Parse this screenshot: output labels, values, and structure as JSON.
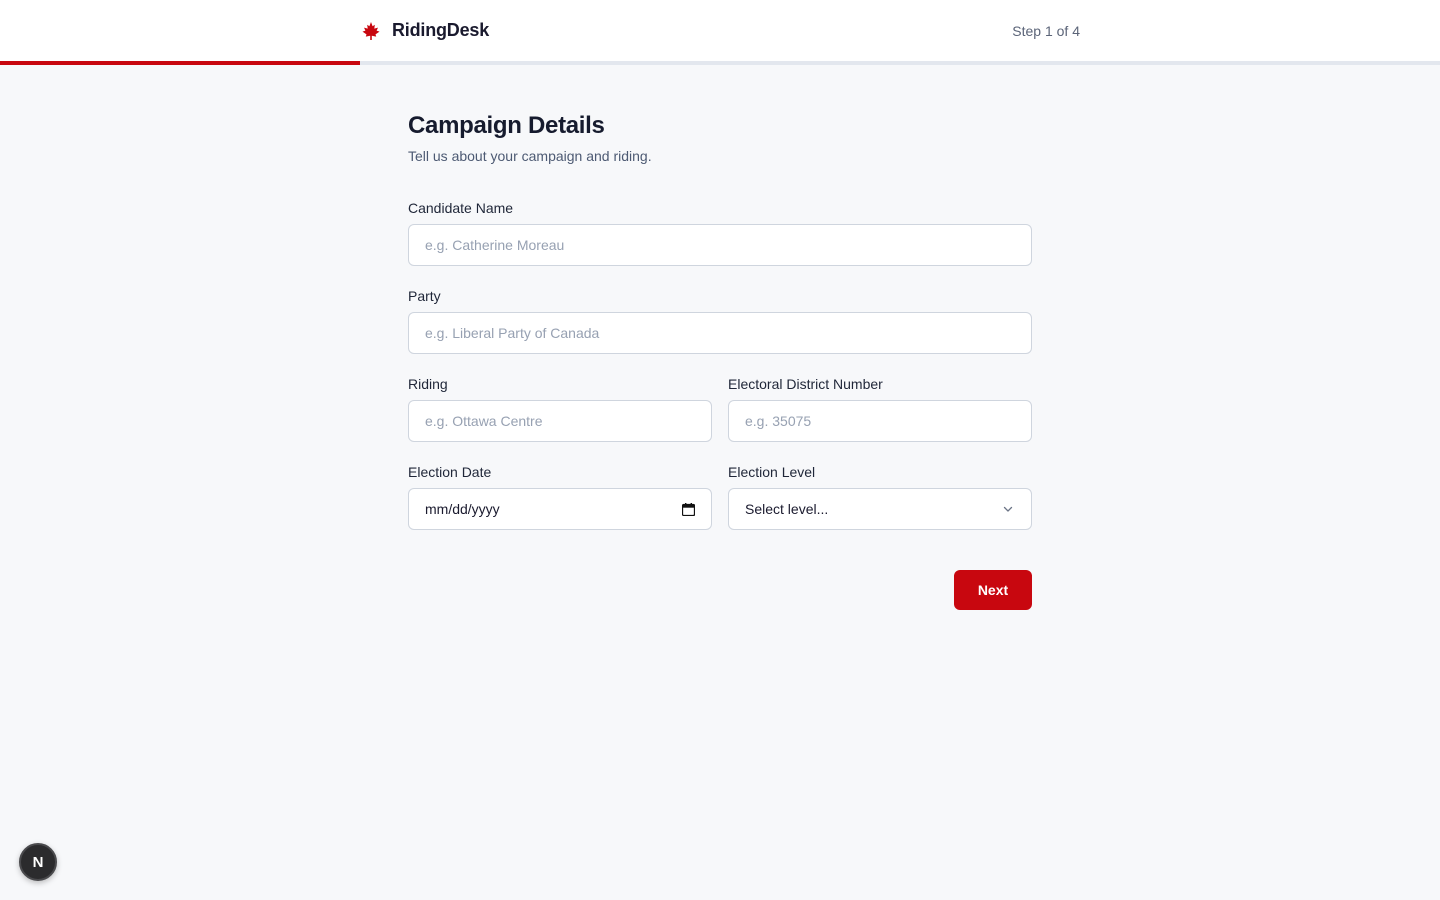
{
  "header": {
    "brand_name": "RidingDesk",
    "brand_icon": "maple-leaf-icon",
    "step_text": "Step 1 of 4",
    "progress_fraction": 0.25,
    "accent_color": "#c8070f"
  },
  "page": {
    "title": "Campaign Details",
    "subtitle": "Tell us about your campaign and riding."
  },
  "form": {
    "candidate_name": {
      "label": "Candidate Name",
      "placeholder": "e.g. Catherine Moreau",
      "value": ""
    },
    "party": {
      "label": "Party",
      "placeholder": "e.g. Liberal Party of Canada",
      "value": ""
    },
    "riding": {
      "label": "Riding",
      "placeholder": "e.g. Ottawa Centre",
      "value": ""
    },
    "district_number": {
      "label": "Electoral District Number",
      "placeholder": "e.g. 35075",
      "value": ""
    },
    "election_date": {
      "label": "Election Date",
      "value": "mm/dd/yyyy",
      "icon": "calendar-icon"
    },
    "election_level": {
      "label": "Election Level",
      "selected": "Select level...",
      "icon": "chevron-down-icon"
    }
  },
  "actions": {
    "next_label": "Next"
  },
  "dev_badge": {
    "label": "N"
  }
}
